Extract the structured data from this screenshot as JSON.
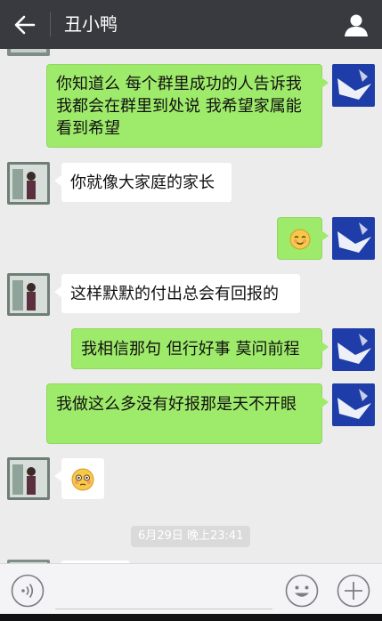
{
  "header": {
    "title": "丑小鸭",
    "back_icon": "arrow-left-icon",
    "profile_icon": "person-icon"
  },
  "messages": [
    {
      "side": "right",
      "text": "你知道么 每个群里成功的人告诉我 我都会在群里到处说  我希望家属能看到希望"
    },
    {
      "side": "left",
      "text": "你就像大家庭的家长"
    },
    {
      "side": "right",
      "emoji": "smiling-face-emoji"
    },
    {
      "side": "left",
      "text": "这样默默的付出总会有回报的"
    },
    {
      "side": "right",
      "text": "我相信那句 但行好事 莫问前程"
    },
    {
      "side": "right",
      "text": "我做这么多没有好报那是天不开眼"
    },
    {
      "side": "left",
      "emoji": "flushed-face-emoji"
    }
  ],
  "timestamp": "6月29日 晚上23:41",
  "input_bar": {
    "voice_icon": "voice-icon",
    "emoji_icon": "emoji-icon",
    "plus_icon": "plus-icon"
  },
  "colors": {
    "topbar": "#393a3f",
    "chat_bg": "#ececec",
    "bubble_sent": "#9eea6a",
    "bubble_received": "#ffffff"
  }
}
